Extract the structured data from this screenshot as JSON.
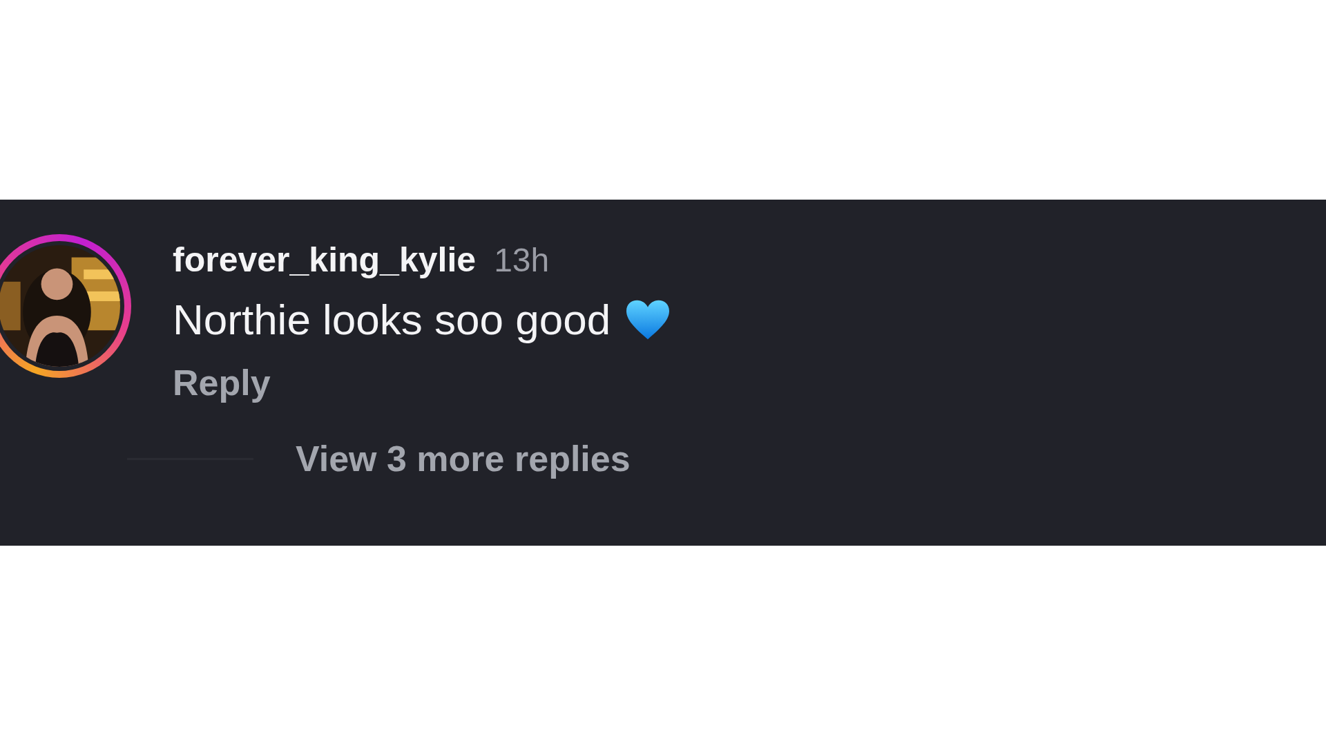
{
  "comment": {
    "avatar": {
      "kind": "picture",
      "story_ring": true
    },
    "username": "forever_king_kylie",
    "time": "13h",
    "text": "Northie looks soo good",
    "reply": "Reply"
  },
  "view_replies": "View 3 more replies"
}
